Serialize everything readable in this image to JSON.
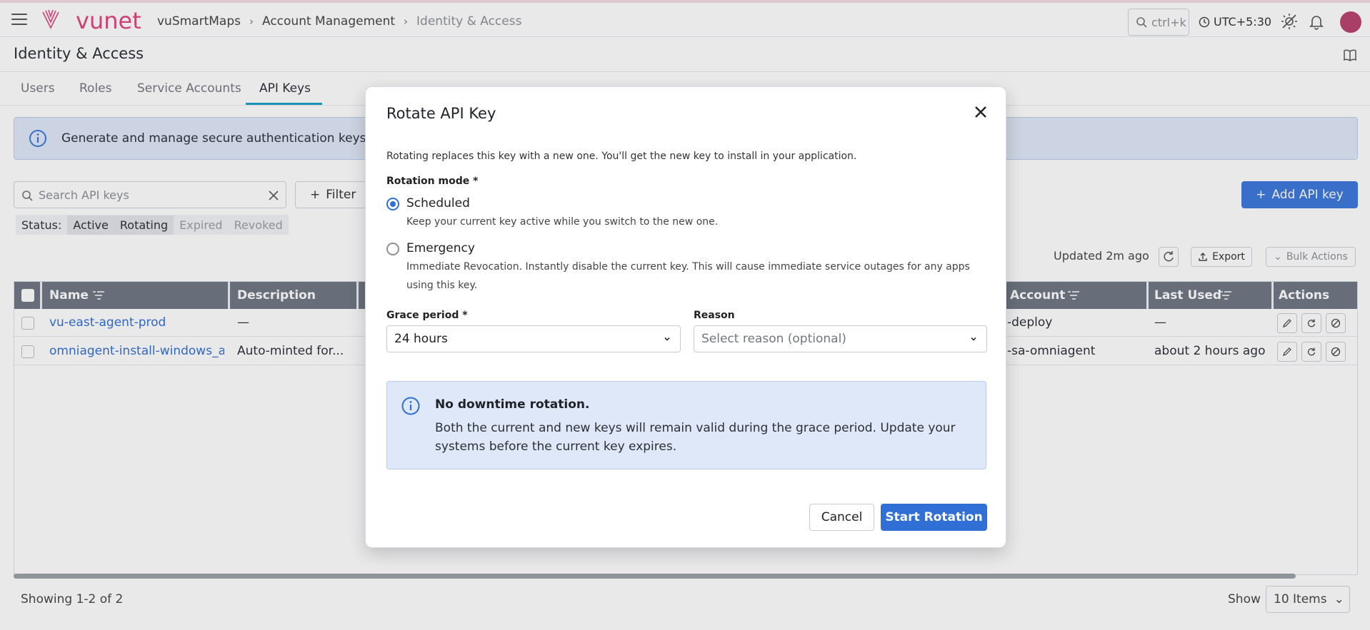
{
  "brand": "vunet",
  "breadcrumb": {
    "items": [
      "vuSmartMaps",
      "Account Management",
      "Identity & Access"
    ],
    "separator": "›"
  },
  "topbar": {
    "search_hint": "ctrl+k",
    "timezone": "UTC+5:30",
    "icons": [
      "menu-icon",
      "search-icon",
      "clock-icon",
      "theme-toggle-icon",
      "bell-icon",
      "avatar"
    ]
  },
  "page": {
    "title": "Identity & Access"
  },
  "tabs": [
    {
      "label": "Users"
    },
    {
      "label": "Roles"
    },
    {
      "label": "Service Accounts"
    },
    {
      "label": "API Keys",
      "active": true
    }
  ],
  "info_banner": {
    "text": "Generate and manage secure authentication keys for yo"
  },
  "toolbar": {
    "search_placeholder": "Search API keys",
    "filter_label": "Filter",
    "add_label": "Add API key",
    "updated_text": "Updated 2m ago",
    "export_label": "Export",
    "bulk_label": "Bulk Actions"
  },
  "status_filter": {
    "label": "Status:",
    "chips": [
      {
        "label": "Active",
        "selected": true
      },
      {
        "label": "Rotating",
        "selected": true
      },
      {
        "label": "Expired",
        "selected": false
      },
      {
        "label": "Revoked",
        "selected": false
      }
    ]
  },
  "table": {
    "columns": [
      "Name",
      "Description",
      "Account",
      "Last Used",
      "Actions"
    ],
    "rows": [
      {
        "name": "vu-east-agent-prod",
        "description": "—",
        "account": "-deploy",
        "last_used": "—"
      },
      {
        "name": "omniagent-install-windows_am",
        "description": "Auto-minted for...",
        "account": "-sa-omniagent",
        "last_used": "about 2 hours ago"
      }
    ]
  },
  "footer": {
    "showing": "Showing 1-2 of 2",
    "show_label": "Show",
    "page_size": "10 Items"
  },
  "modal": {
    "title": "Rotate API Key",
    "description": "Rotating replaces this key with a new one. You'll get the new key to install in your application.",
    "mode_label": "Rotation mode *",
    "modes": [
      {
        "label": "Scheduled",
        "help": "Keep your current key active while you switch to the new one.",
        "selected": true
      },
      {
        "label": "Emergency",
        "help": "Immediate Revocation. Instantly disable the current key. This will cause immediate service outages for any apps using this key.",
        "selected": false
      }
    ],
    "grace_label": "Grace period *",
    "grace_value": "24 hours",
    "reason_label": "Reason",
    "reason_placeholder": "Select reason (optional)",
    "callout_title": "No downtime rotation.",
    "callout_body": "Both the current and new keys will remain valid during the grace period. Update your systems before the current key expires.",
    "cancel_label": "Cancel",
    "confirm_label": "Start Rotation"
  },
  "colors": {
    "accent": "#2f6fd6",
    "brand": "#e0457b",
    "header_bg": "#6f7782",
    "banner_bg": "#dfe8f8"
  }
}
